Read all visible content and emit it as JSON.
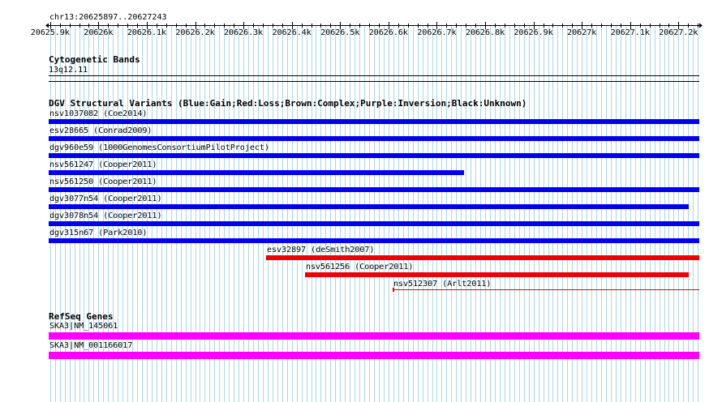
{
  "ruler": {
    "region": "chr13:20625897..20627243",
    "ticks": [
      "20625.9k",
      "20626k",
      "20626.1k",
      "20626.2k",
      "20626.3k",
      "20626.4k",
      "20626.5k",
      "20626.6k",
      "20626.7k",
      "20626.8k",
      "20626.9k",
      "20627k",
      "20627.1k",
      "20627.2k"
    ]
  },
  "cytoband": {
    "title": "Cytogenetic Bands",
    "band": "13q12.11"
  },
  "dgv": {
    "title": "DGV Structural Variants (Blue:Gain;Red:Loss;Brown:Complex;Purple:Inversion;Black:Unknown)",
    "variants": [
      {
        "label": "nsv1037082 (Coe2014)",
        "type": "gain",
        "start": 20625897,
        "end": 20627243
      },
      {
        "label": "esv28665 (Conrad2009)",
        "type": "gain",
        "start": 20625897,
        "end": 20627243
      },
      {
        "label": "dgv960e59 (1000GenomesConsortiumPilotProject)",
        "type": "gain",
        "start": 20625897,
        "end": 20627243
      },
      {
        "label": "nsv561247 (Cooper2011)",
        "type": "gain",
        "start": 20625897,
        "end": 20626756
      },
      {
        "label": "nsv561250 (Cooper2011)",
        "type": "gain",
        "start": 20625897,
        "end": 20627243
      },
      {
        "label": "dgv3077n54 (Cooper2011)",
        "type": "gain",
        "start": 20625897,
        "end": 20627222
      },
      {
        "label": "dgv3078n54 (Cooper2011)",
        "type": "gain",
        "start": 20625897,
        "end": 20627243
      },
      {
        "label": "dgv315n67 (Park2010)",
        "type": "gain",
        "start": 20625897,
        "end": 20627243
      },
      {
        "label": "esv32897 (deSmith2007)",
        "type": "loss",
        "start": 20626347,
        "end": 20627243
      },
      {
        "label": "nsv561256 (Cooper2011)",
        "type": "loss",
        "start": 20626427,
        "end": 20627222
      },
      {
        "label": "nsv512307 (Arlt2011)",
        "type": "loss-thin",
        "start": 20626608,
        "end": 20627243
      }
    ]
  },
  "refseq": {
    "title": "RefSeq Genes",
    "genes": [
      {
        "label": "SKA3|NM_145061",
        "start": 20625897,
        "end": 20627243
      },
      {
        "label": "SKA3|NM_001166017",
        "start": 20625897,
        "end": 20627243
      }
    ]
  },
  "colors": {
    "gain": "#0000ee",
    "loss": "#ee0000",
    "gene": "#ff00ff",
    "grid": "#a8d8e8",
    "axis": "#000000"
  }
}
